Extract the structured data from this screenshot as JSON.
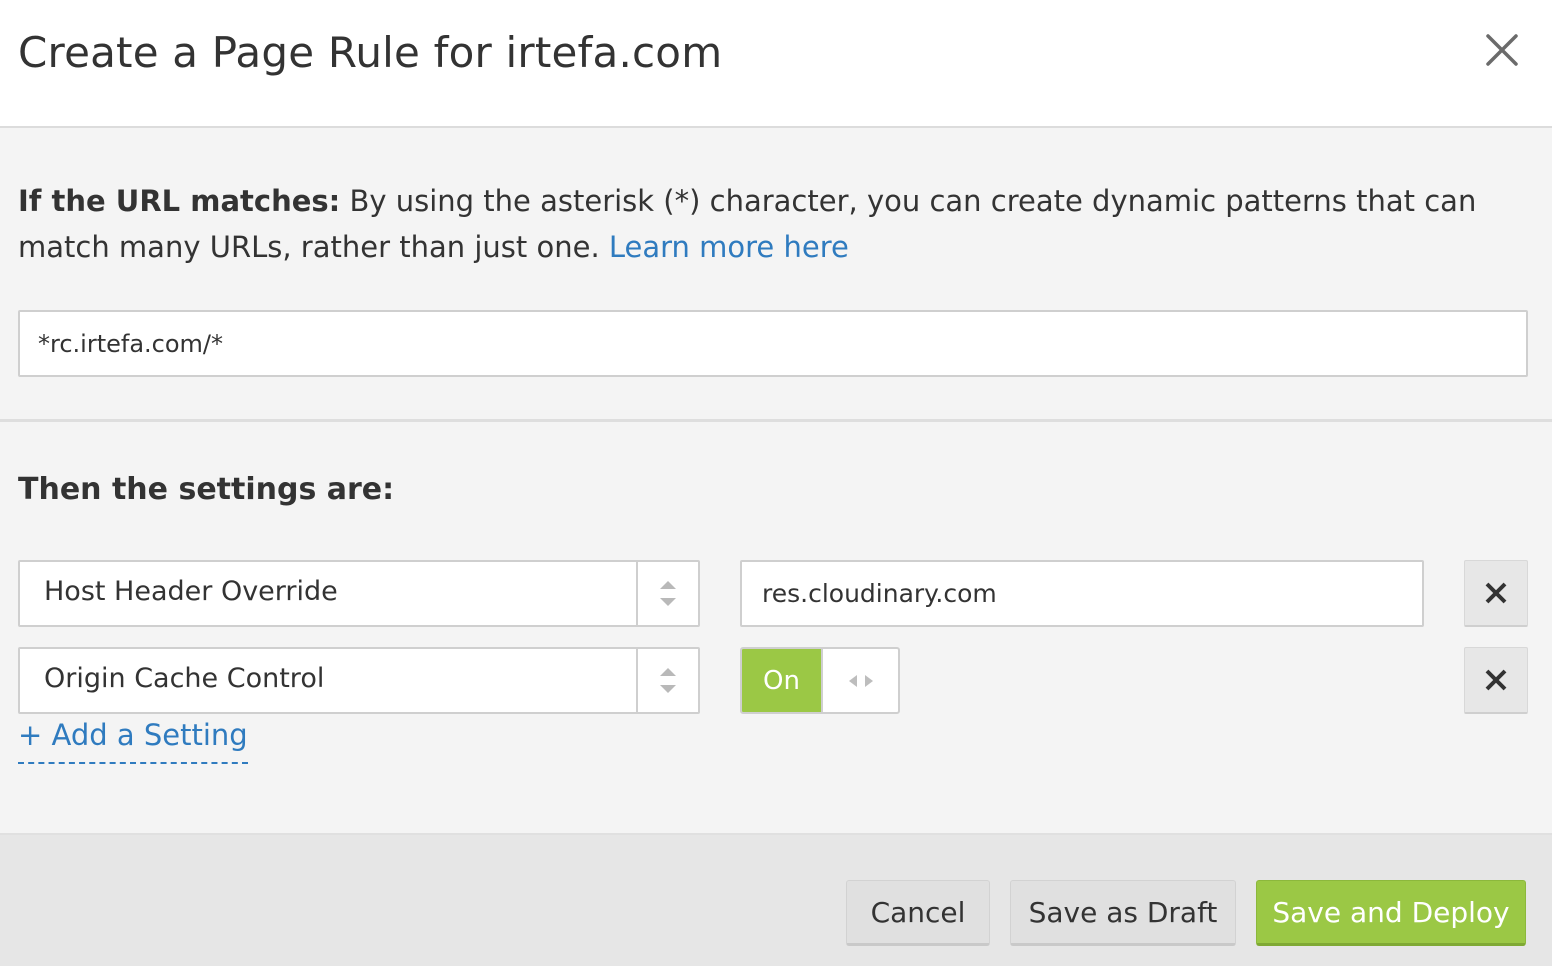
{
  "dialog": {
    "title": "Create a Page Rule for irtefa.com",
    "close_icon": "close-icon"
  },
  "url_section": {
    "label": "If the URL matches:",
    "description": " By using the asterisk (*) character, you can create dynamic patterns that can match many URLs, rather than just one. ",
    "learn_more": "Learn more here",
    "url_value": "*rc.irtefa.com/*"
  },
  "settings_section": {
    "title": "Then the settings are:",
    "settings": [
      {
        "setting": "Host Header Override",
        "value": "res.cloudinary.com"
      },
      {
        "setting": "Origin Cache Control",
        "toggle": "On"
      }
    ],
    "add_setting": "+ Add a Setting"
  },
  "footer": {
    "cancel": "Cancel",
    "save_draft": "Save as Draft",
    "save_deploy": "Save and Deploy"
  },
  "colors": {
    "accent_green": "#9bc845",
    "link_blue": "#2f7bbf",
    "section_bg": "#f4f4f4",
    "footer_bg": "#e6e6e6"
  }
}
